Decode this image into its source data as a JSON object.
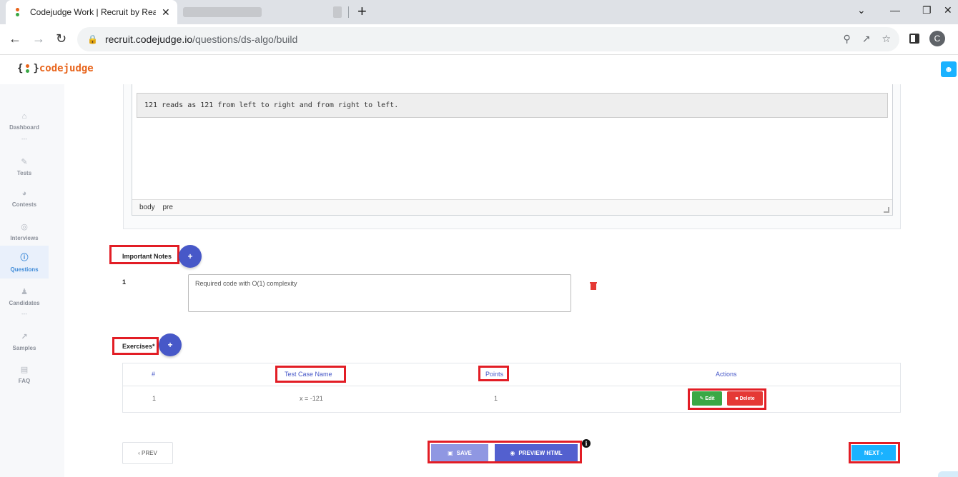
{
  "browser": {
    "tab_title": "Codejudge Work | Recruit by Rea",
    "tab_close": "✕",
    "new_tab": "+",
    "url_host": "recruit.codejudge.io",
    "url_path": "/questions/ds-algo/build",
    "profile_initial": "C",
    "win_min": "—",
    "win_restore": "❐",
    "win_close": "✕",
    "chevron": "⌄"
  },
  "app": {
    "logo_text": "codejudge",
    "logo_open": "{",
    "logo_close": "}"
  },
  "sidebar": {
    "items": [
      {
        "label": "Dashboard",
        "icon": "home-icon"
      },
      {
        "label": "Tests",
        "icon": "pencil-icon"
      },
      {
        "label": "Contests",
        "icon": "pie-chart-icon"
      },
      {
        "label": "Interviews",
        "icon": "location-icon"
      },
      {
        "label": "Questions",
        "icon": "question-icon"
      },
      {
        "label": "Candidates",
        "icon": "users-icon"
      },
      {
        "label": "Samples",
        "icon": "chart-icon"
      },
      {
        "label": "FAQ",
        "icon": "chat-icon"
      }
    ],
    "separator": "---",
    "active": "Questions"
  },
  "editor": {
    "pre_text": "121 reads as 121 from left to right and from right to left.",
    "status_path": [
      "body",
      "pre"
    ]
  },
  "important_notes": {
    "label": "Important Notes",
    "add_label": "+",
    "notes": [
      {
        "index": "1",
        "value": "Required code with O(1) complexity"
      }
    ]
  },
  "exercises": {
    "label": "Exercises*",
    "add_label": "+",
    "columns": [
      "#",
      "Test Case Name",
      "Points",
      "Actions"
    ],
    "rows": [
      {
        "index": "1",
        "name": "x = -121",
        "points": "1"
      }
    ],
    "edit_label": "Edit",
    "delete_label": "Delete"
  },
  "footer": {
    "prev_label": "‹ PREV",
    "save_label": "SAVE",
    "preview_label": "PREVIEW HTML",
    "info": "i",
    "next_label": "NEXT ›"
  },
  "colors": {
    "accent": "#4758c8",
    "highlight": "#e21d25",
    "next": "#1ab2ff",
    "edit": "#3aa845",
    "delete": "#e53935"
  }
}
